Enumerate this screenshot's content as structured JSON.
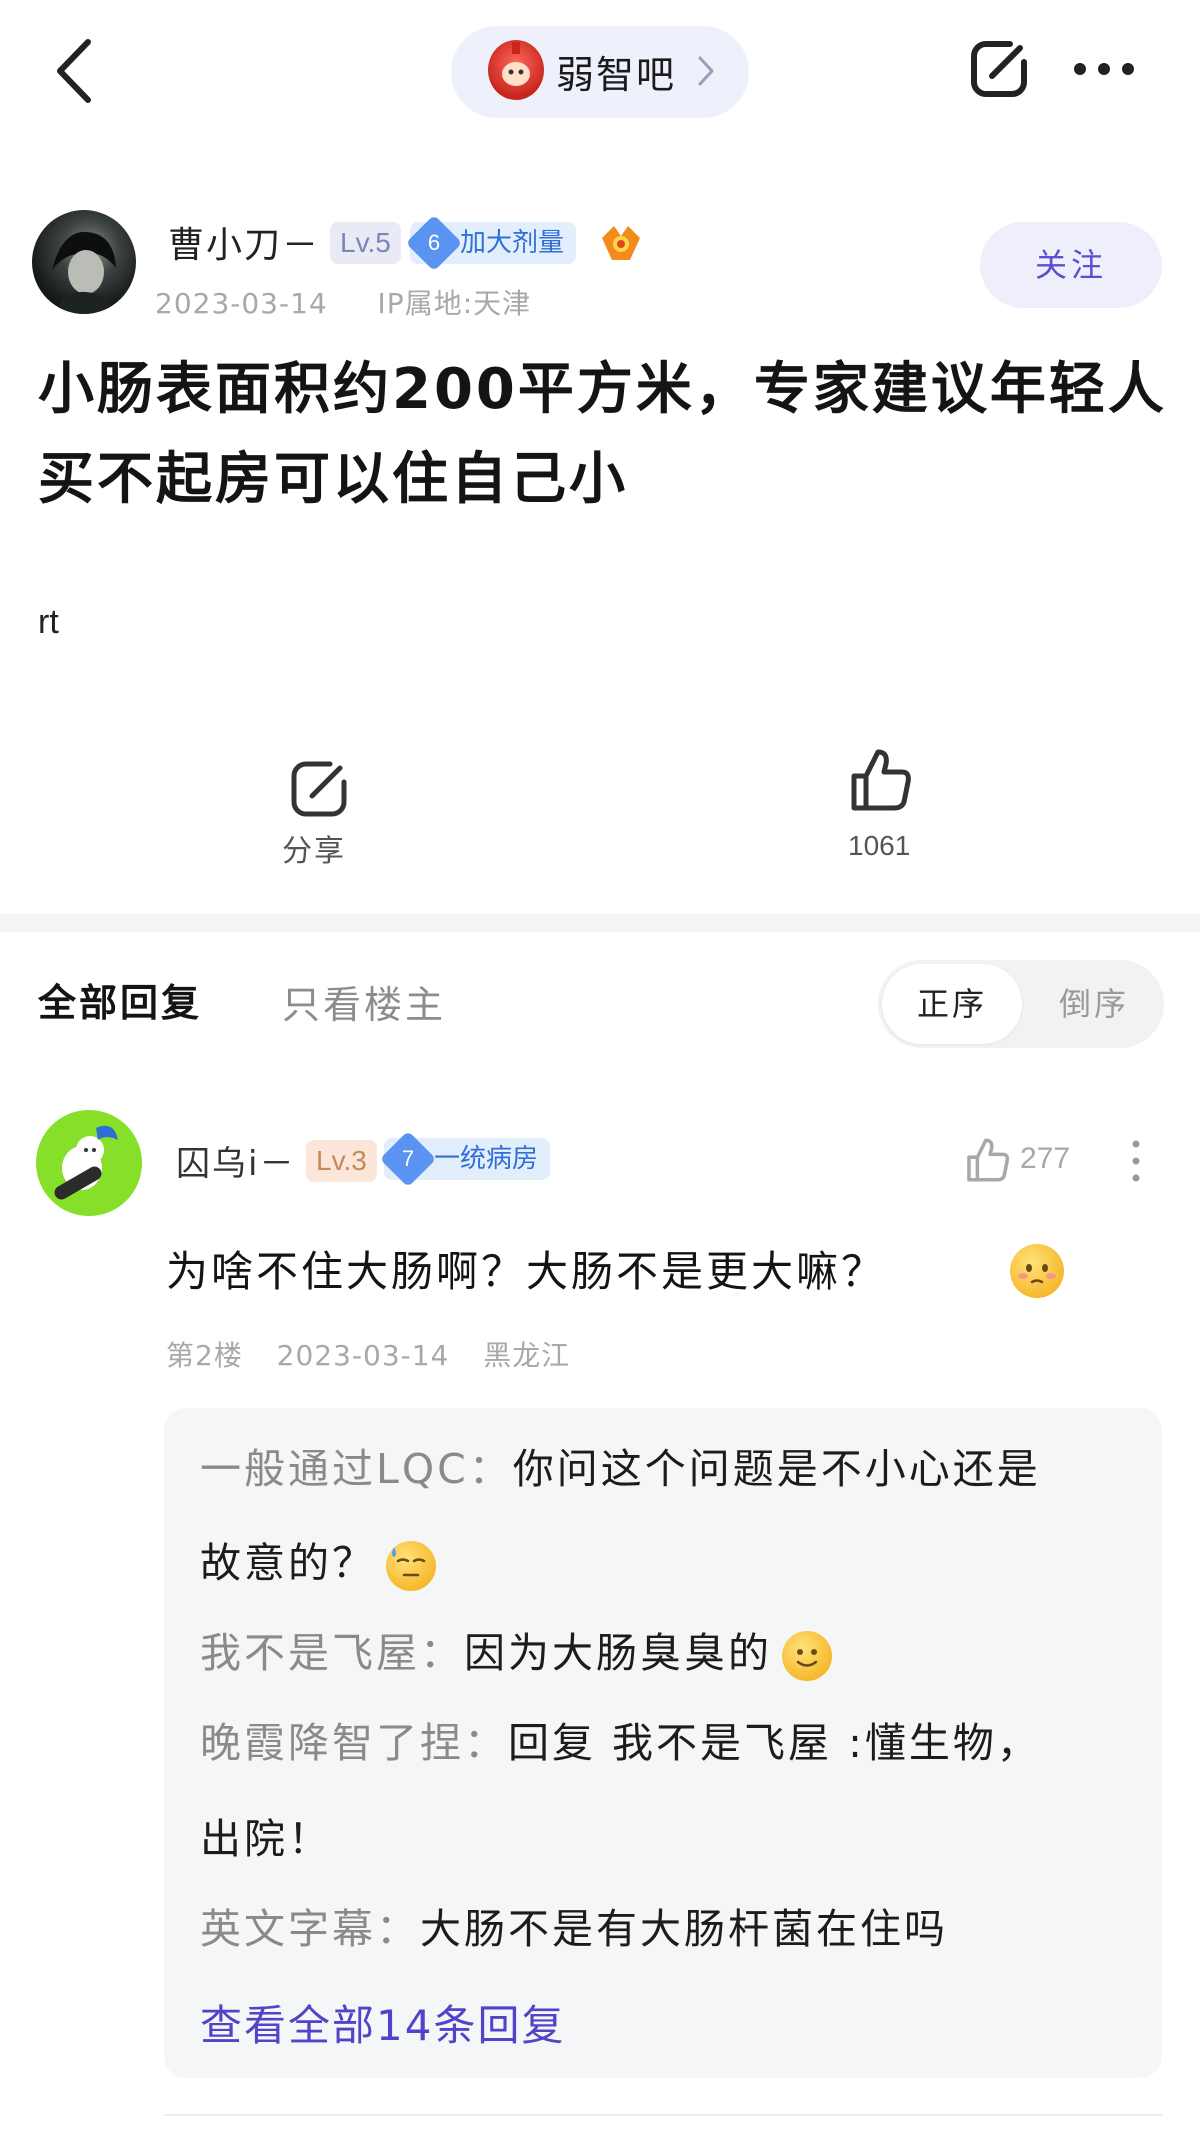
{
  "nav": {
    "forum_name": "弱智吧"
  },
  "post": {
    "author": "曹小刀－",
    "level": "Lv.5",
    "rank_number": "6",
    "rank_title": "加大剂量",
    "date": "2023-03-14",
    "ip_location": "IP属地:天津",
    "follow_label": "关注",
    "title": "小肠表面积约200平方米，专家建议年轻人买不起房可以住自己小",
    "body": "rt",
    "share_label": "分享",
    "like_count": "1061"
  },
  "replies_header": {
    "tab_all": "全部回复",
    "tab_op_only": "只看楼主",
    "sort_asc": "正序",
    "sort_desc": "倒序"
  },
  "reply": {
    "author": "囚乌i－",
    "level": "Lv.3",
    "rank_number": "7",
    "rank_title": "一统病房",
    "like_count": "277",
    "text": "为啥不住大肠啊？大肠不是更大嘛？",
    "floor": "第2楼",
    "date": "2023-03-14",
    "location": "黑龙江",
    "sub_replies": [
      {
        "user": "一般通过LQC：",
        "text": "你问这个问题是不小心还是",
        "text_cont": "故意的？"
      },
      {
        "user": "我不是飞屋：",
        "text": "因为大肠臭臭的"
      },
      {
        "user": "晚霞降智了捏：",
        "text": "回复 我不是飞屋 :懂生物，",
        "text_cont": "出院！"
      },
      {
        "user": "英文字幕：",
        "text": "大肠不是有大肠杆菌在住吗"
      }
    ],
    "see_all": "查看全部14条回复"
  },
  "colors": {
    "accent": "#5044c8",
    "follow_bg": "#eeeffa",
    "tag_blue": "#2f6fd6",
    "avatar_green": "#86e02a"
  }
}
